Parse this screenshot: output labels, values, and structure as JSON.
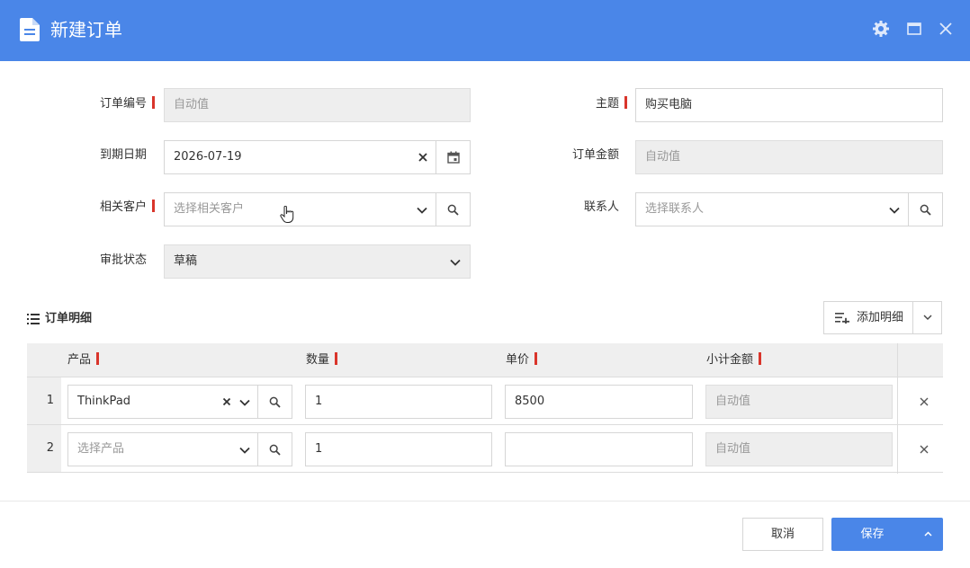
{
  "window": {
    "title": "新建订单"
  },
  "form": {
    "order_no": {
      "label": "订单编号",
      "value": "自动值"
    },
    "subject": {
      "label": "主题",
      "value": "购买电脑"
    },
    "due_date": {
      "label": "到期日期",
      "value": "2026-07-19"
    },
    "order_amount": {
      "label": "订单金额",
      "value": "自动值"
    },
    "customer": {
      "label": "相关客户",
      "placeholder": "选择相关客户"
    },
    "contact": {
      "label": "联系人",
      "placeholder": "选择联系人"
    },
    "approval_status": {
      "label": "审批状态",
      "value": "草稿"
    }
  },
  "details": {
    "title": "订单明细",
    "add_label": "添加明细",
    "columns": [
      "产品",
      "数量",
      "单价",
      "小计金额"
    ],
    "rows": [
      {
        "num": "1",
        "product": "ThinkPad",
        "qty": "1",
        "price": "8500",
        "subtotal": "自动值"
      },
      {
        "num": "2",
        "product_placeholder": "选择产品",
        "qty": "1",
        "price": "",
        "subtotal": "自动值"
      }
    ]
  },
  "footer": {
    "cancel_label": "取消",
    "save_label": "保存"
  },
  "colors": {
    "accent": "#4a86e8",
    "required_mark": "#d9352b",
    "disabled_bg": "#eeeeee"
  }
}
